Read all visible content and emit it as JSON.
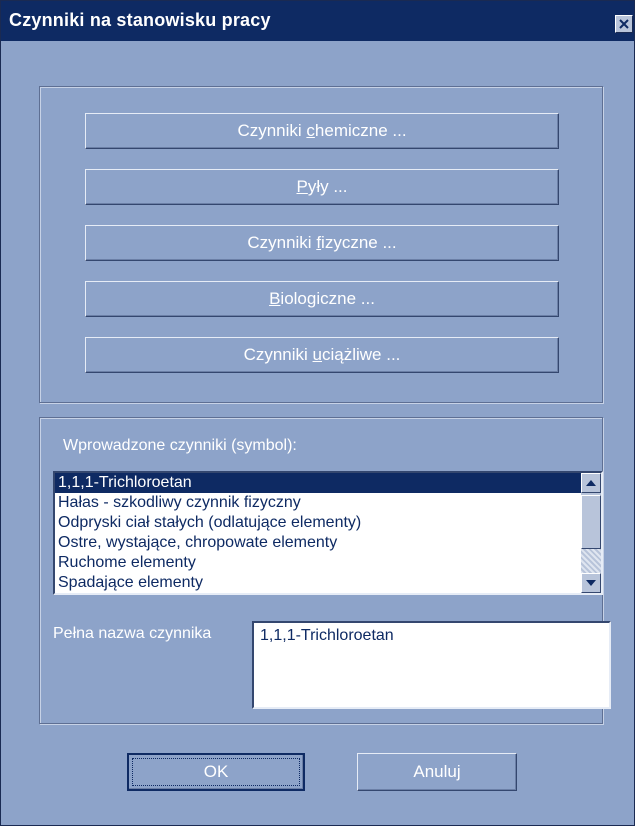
{
  "window": {
    "title": "Czynniki na stanowisku pracy",
    "close_icon": "close-icon"
  },
  "category_buttons": [
    {
      "before": "Czynniki ",
      "mnemonic": "c",
      "after": "hemiczne ..."
    },
    {
      "before": "",
      "mnemonic": "P",
      "after": "yły ..."
    },
    {
      "before": "Czynniki ",
      "mnemonic": "f",
      "after": "izyczne ..."
    },
    {
      "before": "",
      "mnemonic": "B",
      "after": "iologiczne ..."
    },
    {
      "before": "Czynniki ",
      "mnemonic": "u",
      "after": "ciążliwe ..."
    }
  ],
  "factors": {
    "label": "Wprowadzone czynniki (symbol):",
    "items": [
      "1,1,1-Trichloroetan",
      "Hałas - szkodliwy czynnik fizyczny",
      "Odpryski ciał stałych (odlatujące elementy)",
      "Ostre, wystające, chropowate elementy",
      "Ruchome elementy",
      "Spadające elementy"
    ],
    "selected_index": 0
  },
  "full_name": {
    "label": "Pełna nazwa czynnika",
    "value": "1,1,1-Trichloroetan"
  },
  "footer": {
    "ok_label": "OK",
    "cancel_label": "Anuluj"
  },
  "colors": {
    "title_bar": "#0e2a63",
    "dialog_bg": "#8da3c9",
    "selection": "#0e2a63"
  }
}
